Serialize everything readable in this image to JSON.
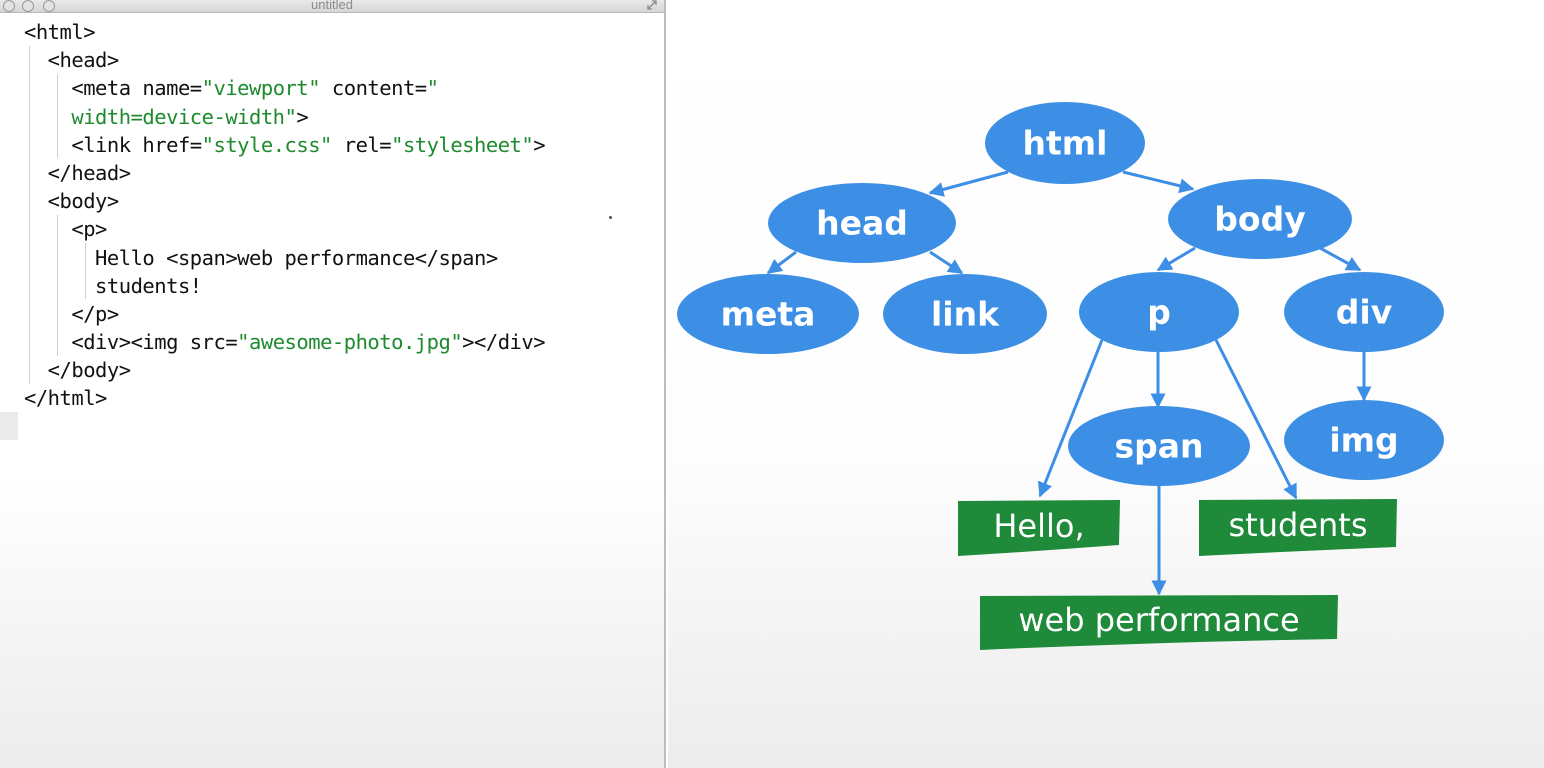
{
  "window": {
    "title": "untitled"
  },
  "editor": {
    "lines": [
      [
        {
          "t": "<html>",
          "c": "tag"
        }
      ],
      [
        {
          "t": "  <head>",
          "c": "tag"
        }
      ],
      [
        {
          "t": "    <meta name=",
          "c": "tag"
        },
        {
          "t": "\"viewport\"",
          "c": "val"
        },
        {
          "t": " content=",
          "c": "tag"
        },
        {
          "t": "\"",
          "c": "val"
        }
      ],
      [
        {
          "t": "    width=device-width\"",
          "c": "val"
        },
        {
          "t": ">",
          "c": "tag"
        }
      ],
      [
        {
          "t": "    <link href=",
          "c": "tag"
        },
        {
          "t": "\"style.css\"",
          "c": "val"
        },
        {
          "t": " rel=",
          "c": "tag"
        },
        {
          "t": "\"stylesheet\"",
          "c": "val"
        },
        {
          "t": ">",
          "c": "tag"
        }
      ],
      [
        {
          "t": "  </head>",
          "c": "tag"
        }
      ],
      [
        {
          "t": "  <body>",
          "c": "tag"
        }
      ],
      [
        {
          "t": "    <p>",
          "c": "tag"
        }
      ],
      [
        {
          "t": "      Hello <span>web performance</span>",
          "c": "tag"
        }
      ],
      [
        {
          "t": "      students!",
          "c": "tag"
        }
      ],
      [
        {
          "t": "    </p>",
          "c": "tag"
        }
      ],
      [
        {
          "t": "    <div><img src=",
          "c": "tag"
        },
        {
          "t": "\"awesome-photo.jpg\"",
          "c": "val"
        },
        {
          "t": "></div>",
          "c": "tag"
        }
      ],
      [
        {
          "t": "  </body>",
          "c": "tag"
        }
      ],
      [
        {
          "t": "</html>",
          "c": "tag"
        }
      ]
    ]
  },
  "tree": {
    "nodes": {
      "html": "html",
      "head": "head",
      "body": "body",
      "meta": "meta",
      "link": "link",
      "p": "p",
      "div": "div",
      "span": "span",
      "img": "img"
    },
    "text_nodes": {
      "hello": "Hello,",
      "students": "students",
      "web_performance": "web performance"
    }
  },
  "colors": {
    "node_fill": "#3d8fe6",
    "text_node_fill": "#1e8a3a",
    "code_value": "#1e8a2e"
  }
}
